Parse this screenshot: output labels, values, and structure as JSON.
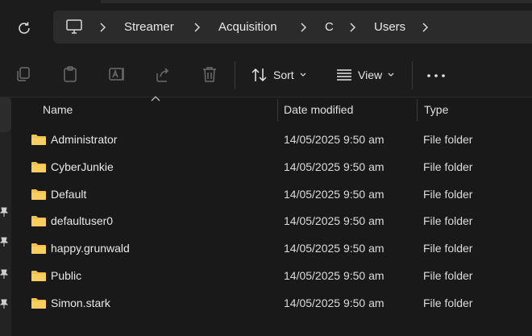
{
  "address_bar": {
    "crumbs": [
      "Streamer",
      "Acquisition",
      "C",
      "Users"
    ]
  },
  "toolbar": {
    "sort_label": "Sort",
    "view_label": "View",
    "more_label": "•••"
  },
  "columns": {
    "name": "Name",
    "date_modified": "Date modified",
    "type": "Type"
  },
  "rows": [
    {
      "name": "Administrator",
      "date": "14/05/2025 9:50 am",
      "type": "File folder"
    },
    {
      "name": "CyberJunkie",
      "date": "14/05/2025 9:50 am",
      "type": "File folder"
    },
    {
      "name": "Default",
      "date": "14/05/2025 9:50 am",
      "type": "File folder"
    },
    {
      "name": "defaultuser0",
      "date": "14/05/2025 9:50 am",
      "type": "File folder"
    },
    {
      "name": "happy.grunwald",
      "date": "14/05/2025 9:50 am",
      "type": "File folder"
    },
    {
      "name": "Public",
      "date": "14/05/2025 9:50 am",
      "type": "File folder"
    },
    {
      "name": "Simon.stark",
      "date": "14/05/2025 9:50 am",
      "type": "File folder"
    }
  ],
  "colors": {
    "background": "#191919",
    "folder": "#f2c14e",
    "text": "#e8e8e8"
  }
}
